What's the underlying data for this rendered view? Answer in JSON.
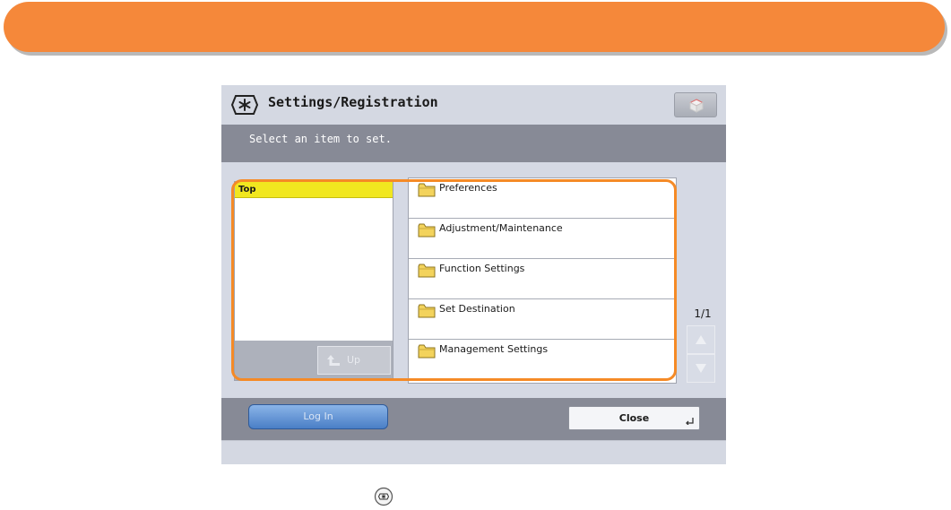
{
  "colors": {
    "banner": "#f5883a",
    "highlight": "#f58a26",
    "selected_row": "#f1e71f",
    "message_bar": "#878a96"
  },
  "header": {
    "icon": "settings-registration-icon",
    "title": "Settings/Registration",
    "corner_icon": "cube-icon"
  },
  "message": "Select an item to set.",
  "tree": {
    "current": "Top",
    "up_label": "Up"
  },
  "menu": {
    "items": [
      {
        "label": "Preferences",
        "icon": "folder-icon"
      },
      {
        "label": "Adjustment/Maintenance",
        "icon": "folder-icon"
      },
      {
        "label": "Function Settings",
        "icon": "folder-icon"
      },
      {
        "label": "Set Destination",
        "icon": "folder-icon"
      },
      {
        "label": "Management Settings",
        "icon": "folder-icon"
      }
    ]
  },
  "pager": {
    "page": "1/1"
  },
  "footer": {
    "login_label": "Log In",
    "close_label": "Close"
  }
}
